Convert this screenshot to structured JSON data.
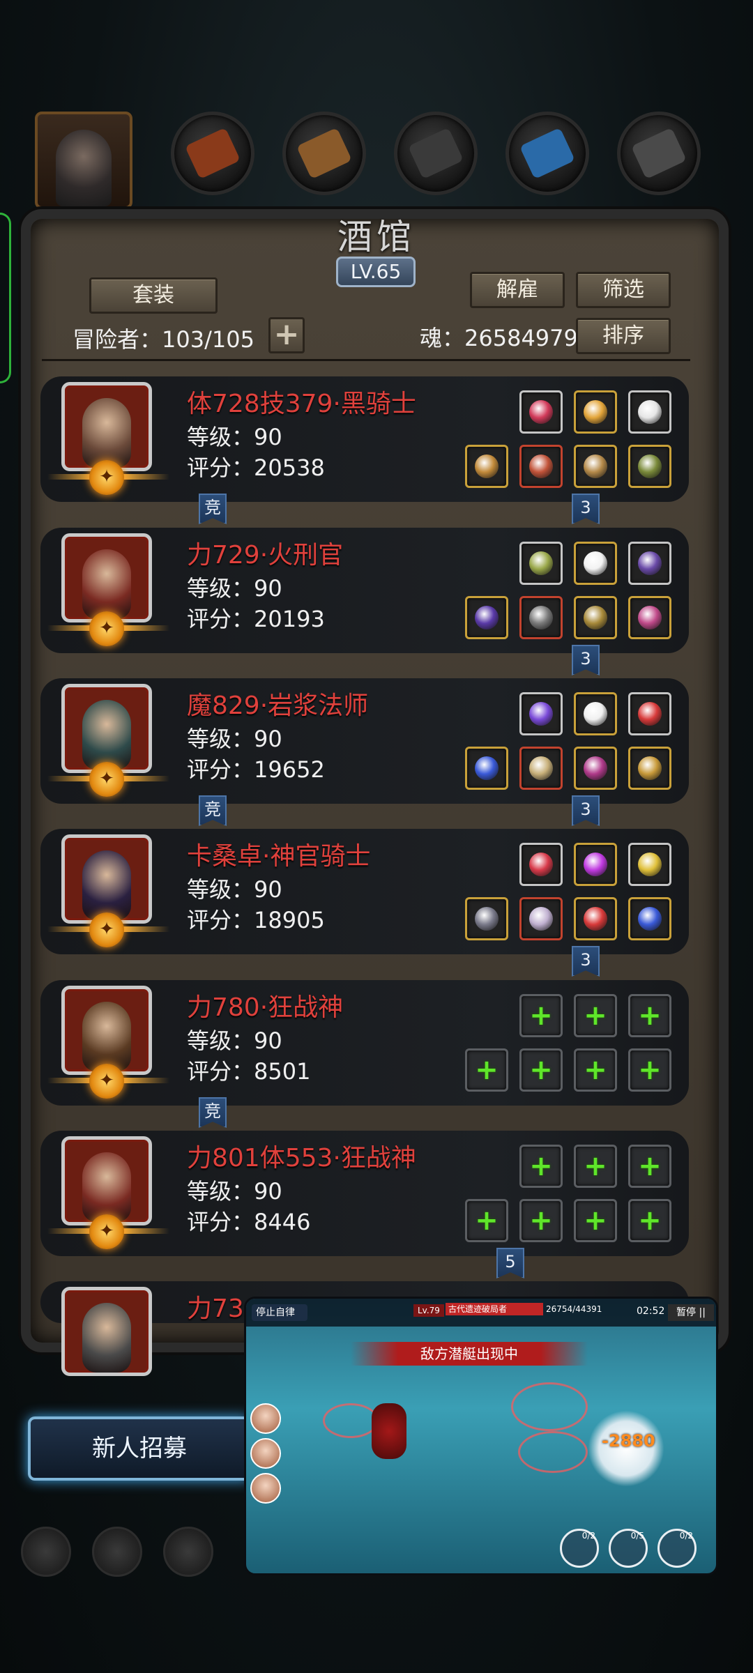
{
  "tavern": {
    "title": "酒馆",
    "level": "LV.65",
    "buttons": {
      "set": "套装",
      "dismiss": "解雇",
      "filter": "筛选",
      "sort": "排序"
    },
    "adventurers_label": "冒险者：103/105",
    "soul_label": "魂：26584979",
    "plus": "+"
  },
  "heroes": [
    {
      "name": "体728技379·黑骑士",
      "level": "等级：90",
      "score": "评分：20538",
      "left_badge": "竞",
      "right_badge": "3",
      "slot_colors": [
        "#d23a5a",
        "#e3a53a",
        "#e6e6e6",
        "#c28a3a",
        "#c2543a",
        "#b58a4a",
        "#7a8a3a"
      ]
    },
    {
      "name": "力729·火刑官",
      "level": "等级：90",
      "score": "评分：20193",
      "left_badge": "",
      "right_badge": "3",
      "slot_colors": [
        "#9aa84a",
        "#f2f2f2",
        "#6a4aa8",
        "#5a3aa8",
        "#7a7a7a",
        "#a88a3a",
        "#c04a8a"
      ]
    },
    {
      "name": "魔829·岩浆法师",
      "level": "等级：90",
      "score": "评分：19652",
      "left_badge": "竞",
      "right_badge": "3",
      "slot_colors": [
        "#7a4ad8",
        "#f0f0f0",
        "#d83a3a",
        "#3a5ad8",
        "#c8b07a",
        "#b03a8a",
        "#c89a3a"
      ]
    },
    {
      "name": "卡桑卓·神官骑士",
      "level": "等级：90",
      "score": "评分：18905",
      "left_badge": "",
      "right_badge": "3",
      "slot_colors": [
        "#d83a4a",
        "#c03ae0",
        "#e0c03a",
        "#7a7a8a",
        "#c0b0d0",
        "#d83a3a",
        "#3a5ad8"
      ]
    },
    {
      "name": "力780·狂战神",
      "level": "等级：90",
      "score": "评分：8501",
      "left_badge": "竞",
      "right_badge": "",
      "slot_colors": []
    },
    {
      "name": "力801体553·狂战神",
      "level": "等级：90",
      "score": "评分：8446",
      "left_badge": "",
      "right_badge": "5",
      "slot_colors": []
    },
    {
      "name": "力73",
      "level": "",
      "score": "",
      "left_badge": "",
      "right_badge": "",
      "slot_colors": []
    }
  ],
  "recruit_button": "新人招募",
  "game_overlay": {
    "stop_auto": "停止自律",
    "boss_level": "Lv.79",
    "boss_name": "古代遗迹破局者",
    "boss_hp": "26754/44391",
    "timer": "02:52",
    "pause": "暂停 ||",
    "banner": "敌方潜艇出现中",
    "damage": "-2880",
    "skill_counts": [
      "0/2",
      "0/5",
      "0/2"
    ]
  },
  "colors": {
    "name_red": "#e0413c",
    "plus_green": "#5fe62a",
    "badge_blue": "#2c4e7a"
  }
}
